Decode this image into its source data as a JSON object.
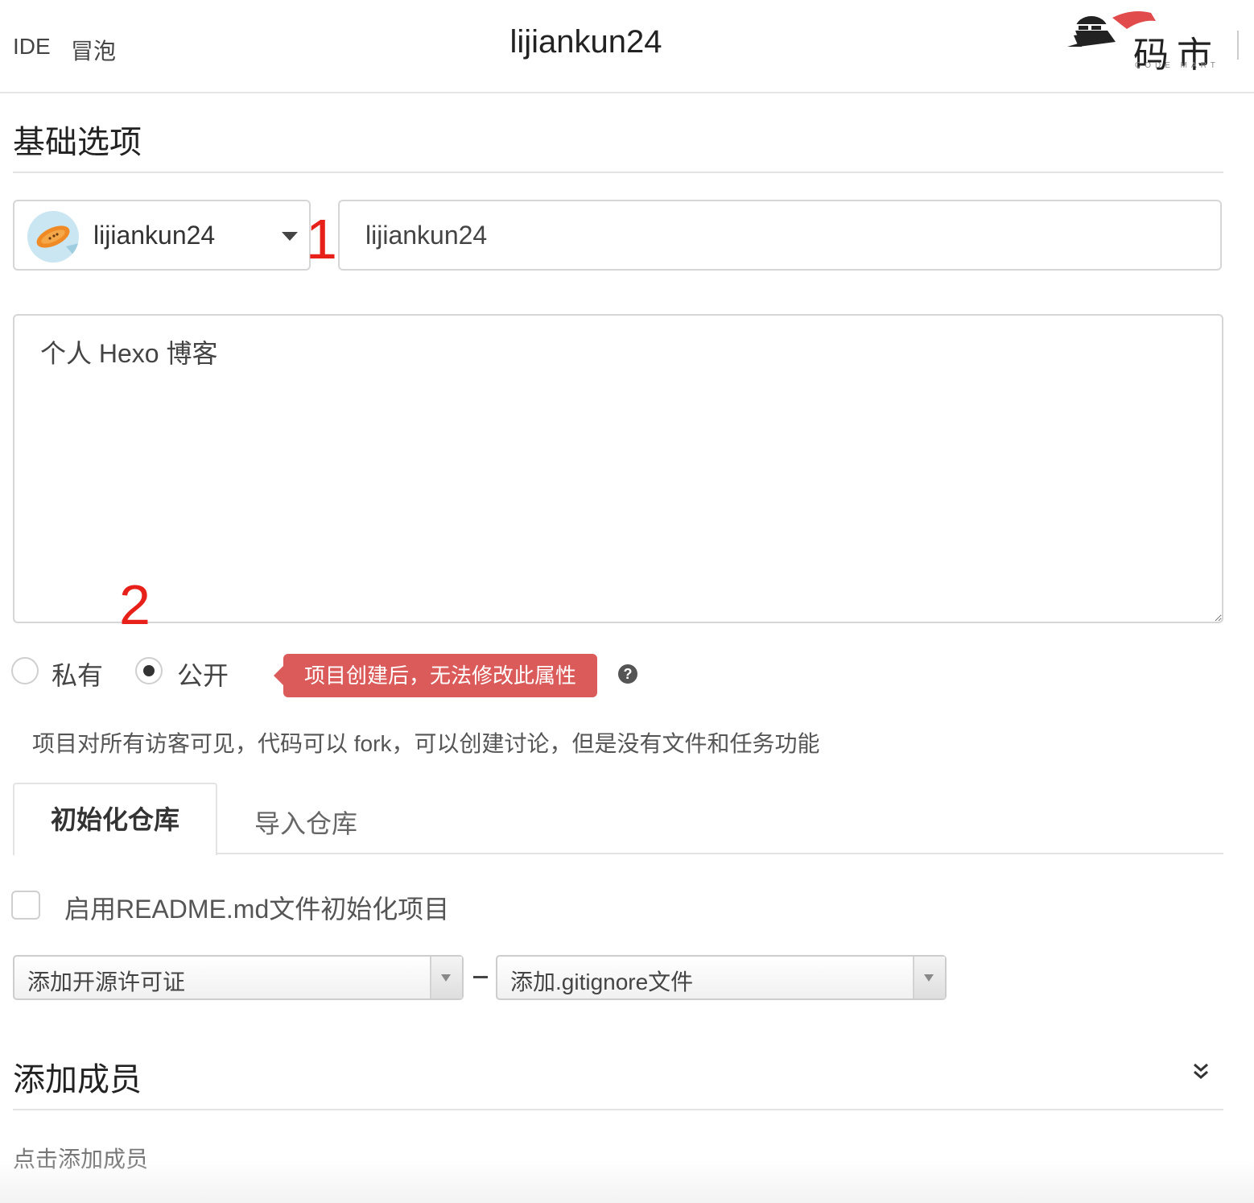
{
  "nav": {
    "links": [
      "IDE",
      "冒泡"
    ],
    "title": "lijiankun24",
    "logo_text": "码市",
    "logo_subtitle": "CODE MART"
  },
  "basic": {
    "title": "基础选项",
    "owner": "lijiankun24",
    "project_name": "lijiankun24",
    "description": "个人 Hexo 博客"
  },
  "annotations": [
    "1",
    "2"
  ],
  "visibility": {
    "options": [
      {
        "label": "私有",
        "checked": false
      },
      {
        "label": "公开",
        "checked": true
      }
    ],
    "tooltip": "项目创建后，无法修改此属性",
    "hint": "项目对所有访客可见，代码可以 fork，可以创建讨论，但是没有文件和任务功能"
  },
  "tabs": [
    {
      "label": "初始化仓库",
      "active": true
    },
    {
      "label": "导入仓库",
      "active": false
    }
  ],
  "init": {
    "readme_label": "启用README.md文件初始化项目",
    "readme_checked": false,
    "license_select": "添加开源许可证",
    "gitignore_select": "添加.gitignore文件"
  },
  "members": {
    "title": "添加成员",
    "add_link": "点击添加成员"
  },
  "colors": {
    "annotation": "#e8201a",
    "tooltip_bg": "#db5a5a",
    "border": "#d6d6d6"
  }
}
